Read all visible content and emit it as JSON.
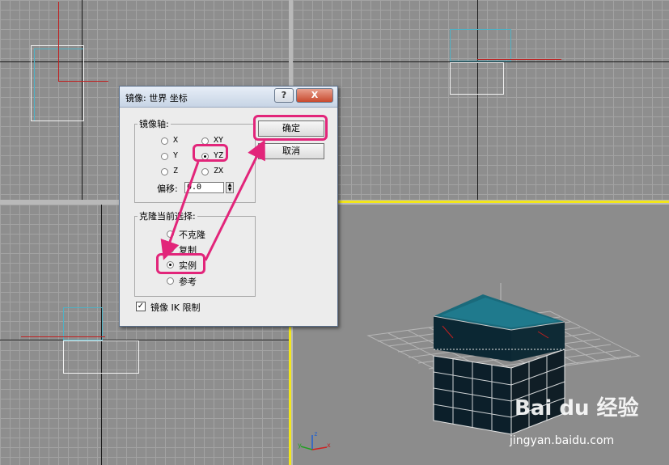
{
  "dialog": {
    "title": "镜像: 世界 坐标",
    "help_label": "?",
    "close_label": "X",
    "mirror_axis": {
      "label": "镜像轴:",
      "options": [
        {
          "label": "X",
          "selected": false
        },
        {
          "label": "Y",
          "selected": false
        },
        {
          "label": "Z",
          "selected": false
        },
        {
          "label": "XY",
          "selected": false
        },
        {
          "label": "YZ",
          "selected": true
        },
        {
          "label": "ZX",
          "selected": false
        }
      ],
      "offset_label": "偏移:",
      "offset_value": "0.0"
    },
    "clone": {
      "label": "克隆当前选择:",
      "options": [
        {
          "label": "不克隆",
          "selected": false
        },
        {
          "label": "复制",
          "selected": false
        },
        {
          "label": "实例",
          "selected": true
        },
        {
          "label": "参考",
          "selected": false
        }
      ]
    },
    "ok_label": "确定",
    "cancel_label": "取消",
    "mirror_ik_label": "镜像 IK 限制",
    "mirror_ik_checked": true
  },
  "highlight_color": "#e2257a",
  "viewport_axis_labels": {
    "x": "x",
    "y": "y",
    "z": "z"
  },
  "watermark": {
    "main": "Bai du 经验",
    "sub": "jingyan.baidu.com"
  }
}
